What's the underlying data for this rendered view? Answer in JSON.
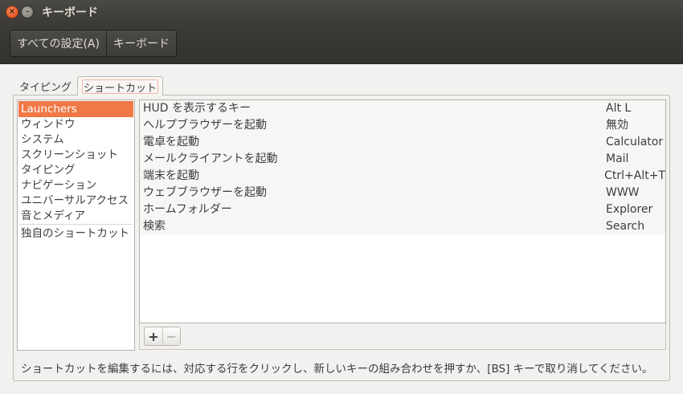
{
  "window": {
    "title": "キーボード",
    "close_glyph": "×",
    "min_glyph": "–"
  },
  "toolbar": {
    "crumbs": [
      "すべての設定(A)",
      "キーボード"
    ]
  },
  "tabs": [
    {
      "label": "タイピング",
      "active": false
    },
    {
      "label": "ショートカット",
      "active": true
    }
  ],
  "categories": [
    "Launchers",
    "ウィンドウ",
    "システム",
    "スクリーンショット",
    "タイピング",
    "ナビゲーション",
    "ユニバーサルアクセス",
    "音とメディア"
  ],
  "custom_category": "独自のショートカット",
  "selected_category": "Launchers",
  "shortcuts": [
    {
      "name": "HUD を表示するキー",
      "key": "Alt L"
    },
    {
      "name": "ヘルプブラウザーを起動",
      "key": "無効"
    },
    {
      "name": "電卓を起動",
      "key": "Calculator"
    },
    {
      "name": "メールクライアントを起動",
      "key": "Mail"
    },
    {
      "name": "端末を起動",
      "key": "Ctrl+Alt+T"
    },
    {
      "name": "ウェブブラウザーを起動",
      "key": "WWW"
    },
    {
      "name": "ホームフォルダー",
      "key": "Explorer"
    },
    {
      "name": "検索",
      "key": "Search"
    }
  ],
  "buttons": {
    "add": "+",
    "remove": "−"
  },
  "hint": "ショートカットを編集するには、対応する行をクリックし、新しいキーの組み合わせを押すか、[BS] キーで取り消してください。",
  "colors": {
    "accent": "#f07746",
    "titlebar": "#3c3b37"
  }
}
